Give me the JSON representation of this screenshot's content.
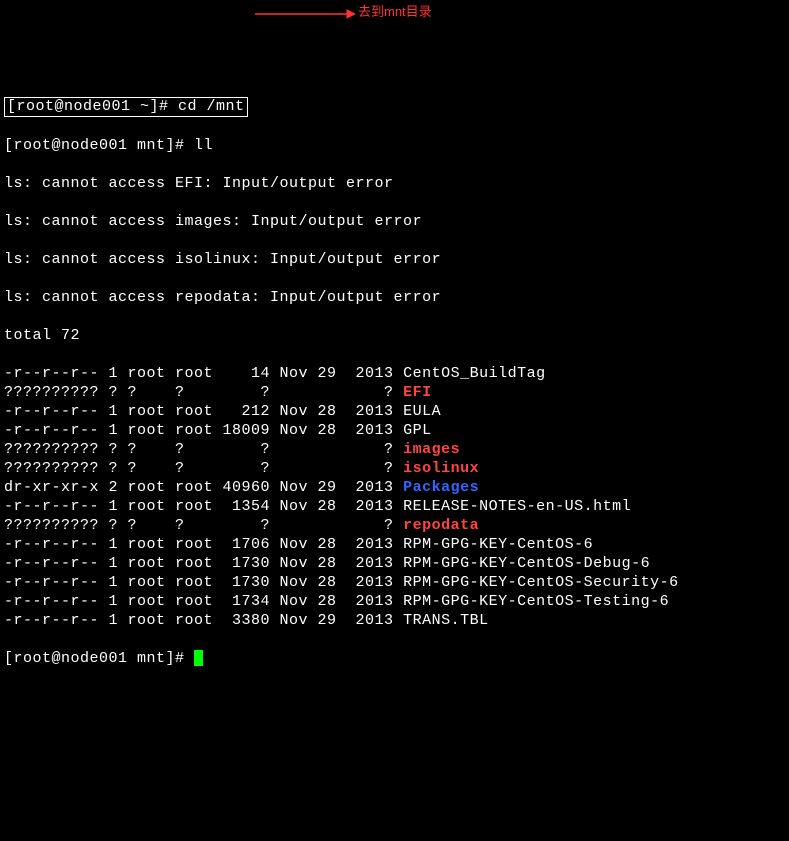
{
  "annotation": "去到mnt目录",
  "prompt1_box": "[root@node001 ~]# ",
  "cmd1": "cd /mnt",
  "prompt2": "[root@node001 mnt]# ",
  "cmd2": "ll",
  "errors": [
    "ls: cannot access EFI: Input/output error",
    "ls: cannot access images: Input/output error",
    "ls: cannot access isolinux: Input/output error",
    "ls: cannot access repodata: Input/output error"
  ],
  "total": "total 72",
  "rows": [
    {
      "perm": "-r--r--r--",
      "l": "1",
      "u": "root",
      "g": "root",
      "sz": "   14",
      "m": "Nov",
      "d": "29",
      "y": " 2013",
      "name": "CentOS_BuildTag",
      "cls": ""
    },
    {
      "perm": "??????????",
      "l": "?",
      "u": "?   ",
      "g": "?   ",
      "sz": "    ?",
      "m": "   ",
      "d": "  ",
      "y": "    ?",
      "name": "EFI",
      "cls": "brightred"
    },
    {
      "perm": "-r--r--r--",
      "l": "1",
      "u": "root",
      "g": "root",
      "sz": "  212",
      "m": "Nov",
      "d": "28",
      "y": " 2013",
      "name": "EULA",
      "cls": ""
    },
    {
      "perm": "-r--r--r--",
      "l": "1",
      "u": "root",
      "g": "root",
      "sz": "18009",
      "m": "Nov",
      "d": "28",
      "y": " 2013",
      "name": "GPL",
      "cls": ""
    },
    {
      "perm": "??????????",
      "l": "?",
      "u": "?   ",
      "g": "?   ",
      "sz": "    ?",
      "m": "   ",
      "d": "  ",
      "y": "    ?",
      "name": "images",
      "cls": "brightred"
    },
    {
      "perm": "??????????",
      "l": "?",
      "u": "?   ",
      "g": "?   ",
      "sz": "    ?",
      "m": "   ",
      "d": "  ",
      "y": "    ?",
      "name": "isolinux",
      "cls": "brightred"
    },
    {
      "perm": "dr-xr-xr-x",
      "l": "2",
      "u": "root",
      "g": "root",
      "sz": "40960",
      "m": "Nov",
      "d": "29",
      "y": " 2013",
      "name": "Packages",
      "cls": "blue"
    },
    {
      "perm": "-r--r--r--",
      "l": "1",
      "u": "root",
      "g": "root",
      "sz": " 1354",
      "m": "Nov",
      "d": "28",
      "y": " 2013",
      "name": "RELEASE-NOTES-en-US.html",
      "cls": ""
    },
    {
      "perm": "??????????",
      "l": "?",
      "u": "?   ",
      "g": "?   ",
      "sz": "    ?",
      "m": "   ",
      "d": "  ",
      "y": "    ?",
      "name": "repodata",
      "cls": "brightred"
    },
    {
      "perm": "-r--r--r--",
      "l": "1",
      "u": "root",
      "g": "root",
      "sz": " 1706",
      "m": "Nov",
      "d": "28",
      "y": " 2013",
      "name": "RPM-GPG-KEY-CentOS-6",
      "cls": ""
    },
    {
      "perm": "-r--r--r--",
      "l": "1",
      "u": "root",
      "g": "root",
      "sz": " 1730",
      "m": "Nov",
      "d": "28",
      "y": " 2013",
      "name": "RPM-GPG-KEY-CentOS-Debug-6",
      "cls": ""
    },
    {
      "perm": "-r--r--r--",
      "l": "1",
      "u": "root",
      "g": "root",
      "sz": " 1730",
      "m": "Nov",
      "d": "28",
      "y": " 2013",
      "name": "RPM-GPG-KEY-CentOS-Security-6",
      "cls": ""
    },
    {
      "perm": "-r--r--r--",
      "l": "1",
      "u": "root",
      "g": "root",
      "sz": " 1734",
      "m": "Nov",
      "d": "28",
      "y": " 2013",
      "name": "RPM-GPG-KEY-CentOS-Testing-6",
      "cls": ""
    },
    {
      "perm": "-r--r--r--",
      "l": "1",
      "u": "root",
      "g": "root",
      "sz": " 3380",
      "m": "Nov",
      "d": "29",
      "y": " 2013",
      "name": "TRANS.TBL",
      "cls": ""
    }
  ],
  "prompt3": "[root@node001 mnt]# "
}
